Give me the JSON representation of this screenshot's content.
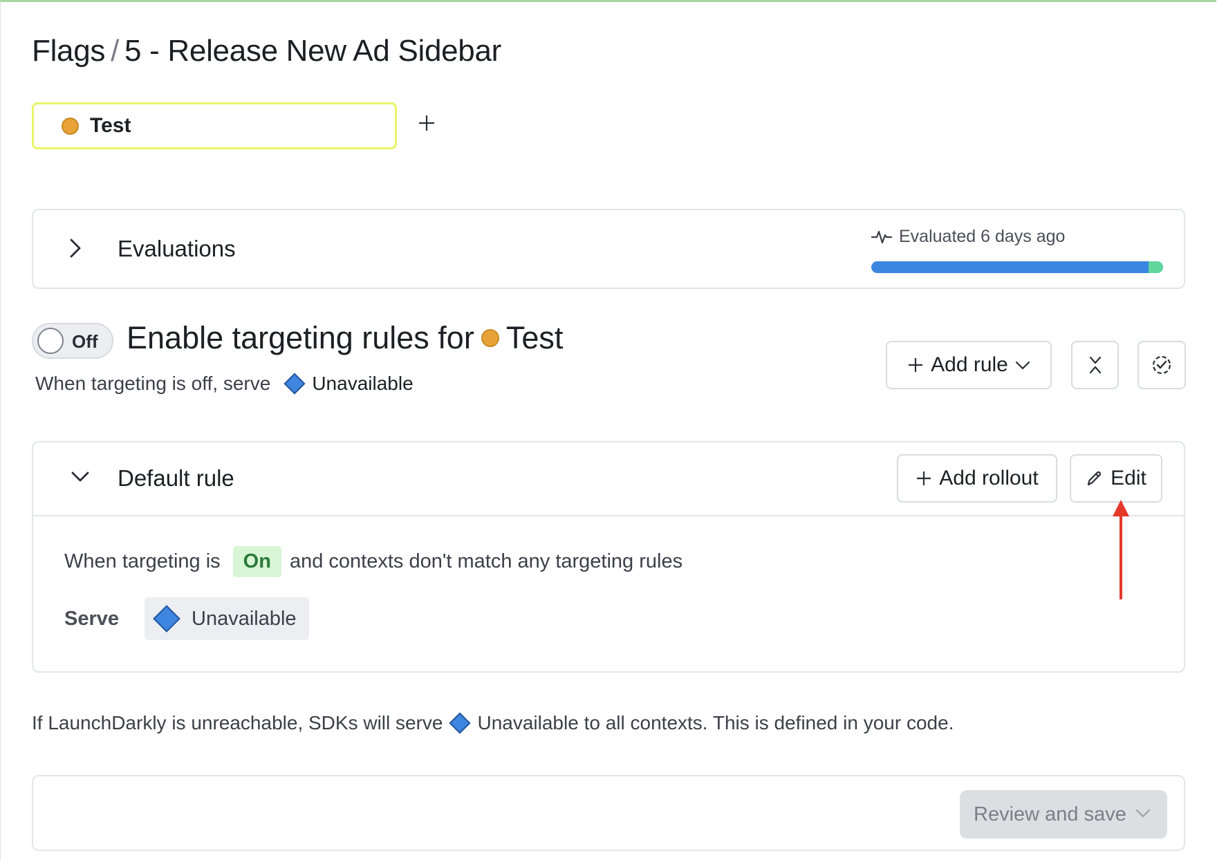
{
  "breadcrumb": {
    "root": "Flags",
    "separator": "/",
    "flag": "5 - Release New Ad Sidebar"
  },
  "environment_tab": {
    "label": "Test",
    "dot_color": "#e8a23a"
  },
  "evaluations": {
    "heading": "Evaluations",
    "last_evaluated": "Evaluated 6 days ago",
    "bar_colors": [
      "#3a86e0",
      "#5fd69e"
    ],
    "green_share": 0.05
  },
  "targeting": {
    "toggle_label": "Off",
    "title_prefix": "Enable targeting rules for",
    "environment": "Test",
    "off_serve_text": "When targeting is off, serve",
    "off_variation": "Unavailable"
  },
  "toolbar": {
    "add_rule": "Add rule"
  },
  "default_rule": {
    "heading": "Default rule",
    "add_rollout": "Add rollout",
    "edit": "Edit",
    "when_prefix": "When targeting is",
    "on_badge": "On",
    "when_suffix": "and contexts don't match any targeting rules",
    "serve_label": "Serve",
    "serve_variation": "Unavailable"
  },
  "fallback": {
    "prefix": "If LaunchDarkly is unreachable, SDKs will serve",
    "variation": "Unavailable",
    "suffix": "to all contexts. This is defined in your code."
  },
  "save": {
    "review_label": "Review and save"
  },
  "colors": {
    "variation_diamond": "#3f86e0",
    "annotation_arrow": "#e5392b",
    "tab_highlight": "#e8f56a"
  }
}
